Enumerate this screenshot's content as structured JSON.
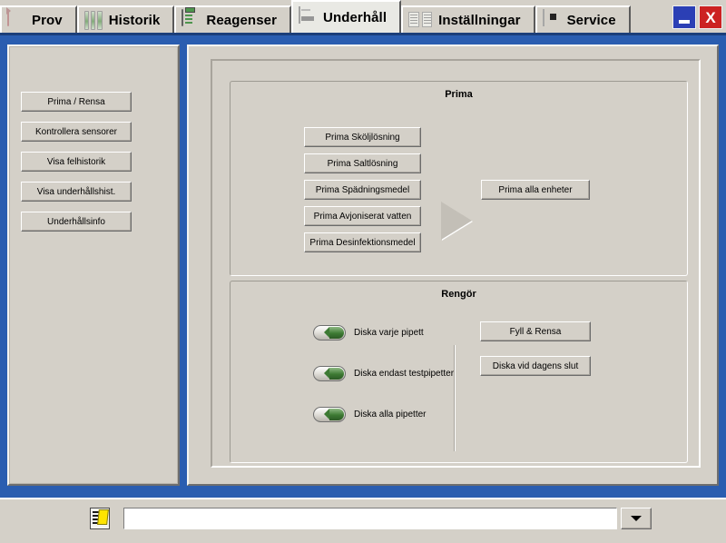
{
  "window": {
    "minimize_label": "_",
    "close_label": "X",
    "accent_blue": "#2a5db0",
    "face_gray": "#d4d0c8"
  },
  "tabs": [
    {
      "label": "Prov",
      "icon": "sample-tube-icon",
      "active": false
    },
    {
      "label": "Historik",
      "icon": "test-tubes-icon",
      "active": false
    },
    {
      "label": "Reagenser",
      "icon": "clipboard-icon",
      "active": false
    },
    {
      "label": "Underhåll",
      "icon": "maintenance-icon",
      "active": true
    },
    {
      "label": "Inställningar",
      "icon": "settings-list-icon",
      "active": false
    },
    {
      "label": "Service",
      "icon": "service-icon",
      "active": false
    }
  ],
  "sidebar": {
    "items": [
      {
        "label": "Prima / Rensa"
      },
      {
        "label": "Kontrollera sensorer"
      },
      {
        "label": "Visa felhistorik"
      },
      {
        "label": "Visa underhållshist."
      },
      {
        "label": "Underhållsinfo"
      }
    ]
  },
  "prima": {
    "title": "Prima",
    "buttons": [
      {
        "label": "Prima Sköljlösning"
      },
      {
        "label": "Prima Saltlösning"
      },
      {
        "label": "Prima Spädningsmedel"
      },
      {
        "label": "Prima Avjoniserat vatten"
      },
      {
        "label": "Prima Desinfektionsmedel"
      }
    ],
    "all_button": {
      "label": "Prima alla enheter"
    },
    "arrow_icon": "arrow-right-icon"
  },
  "rengor": {
    "title": "Rengör",
    "toggles": [
      {
        "label": "Diska varje pipett",
        "state": "on"
      },
      {
        "label": "Diska endast testpipetter",
        "state": "on"
      },
      {
        "label": "Diska alla pipetter",
        "state": "on"
      }
    ],
    "buttons": [
      {
        "label": "Fyll & Rensa"
      },
      {
        "label": "Diska vid dagens slut"
      }
    ]
  },
  "statusbar": {
    "icon": "note-list-icon",
    "message": "",
    "placeholder": "",
    "dropdown_icon": "chevron-down-icon"
  }
}
